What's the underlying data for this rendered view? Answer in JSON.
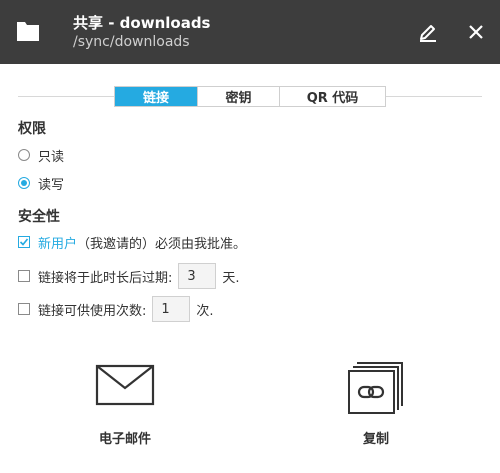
{
  "header": {
    "title": "共享 - downloads",
    "subtitle": "/sync/downloads",
    "icons": {
      "folder": "folder-icon",
      "edit": "pencil-icon",
      "close": "close-icon"
    }
  },
  "tabs": [
    {
      "label": "链接",
      "active": true
    },
    {
      "label": "密钥",
      "active": false
    },
    {
      "label": "QR 代码",
      "active": false
    }
  ],
  "permissions": {
    "title": "权限",
    "options": [
      {
        "label": "只读",
        "selected": false
      },
      {
        "label": "读写",
        "selected": true
      }
    ]
  },
  "security": {
    "title": "安全性",
    "approval": {
      "checked": true,
      "highlight": "新用户",
      "rest": " （我邀请的）必须由我批准。"
    },
    "expire": {
      "checked": false,
      "prefix": "链接将于此时长后过期:",
      "value": "3",
      "suffix": "天."
    },
    "uses": {
      "checked": false,
      "prefix": "链接可供使用次数:",
      "value": "1",
      "suffix": "次."
    }
  },
  "actions": {
    "email": {
      "label": "电子邮件",
      "icon": "envelope-icon"
    },
    "copy": {
      "label": "复制",
      "icon": "copy-link-icon"
    }
  },
  "colors": {
    "header_bg": "#3d3d3d",
    "accent": "#25aae1",
    "text": "#333333"
  }
}
